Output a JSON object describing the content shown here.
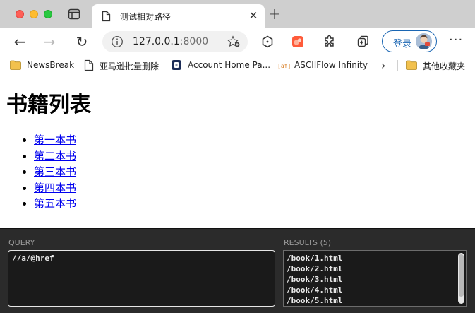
{
  "tab": {
    "title": "测试相对路径",
    "close_glyph": "✕",
    "new_tab_glyph": "+"
  },
  "toolbar": {
    "back_glyph": "←",
    "forward_glyph": "→",
    "reload_glyph": "↻",
    "url_host": "127.0.0.1",
    "url_port": ":8000",
    "login_label": "登录",
    "more_glyph": "···"
  },
  "bookmarks": {
    "items": [
      {
        "label": "NewsBreak",
        "icon": "folder-icon"
      },
      {
        "label": "亚马逊批量删除",
        "icon": "page-icon"
      },
      {
        "label": "Account Home Pa...",
        "icon": "account-icon"
      },
      {
        "label": "ASCIIFlow Infinity",
        "icon": "asciiflow-icon"
      }
    ],
    "overflow_glyph": "›",
    "other_folder_label": "其他收藏夹"
  },
  "page": {
    "heading": "书籍列表",
    "books": [
      "第一本书",
      "第二本书",
      "第三本书",
      "第四本书",
      "第五本书"
    ]
  },
  "xpath_panel": {
    "query_label": "QUERY",
    "query_value": "//a/@href",
    "results_label": "RESULTS (5)",
    "results": [
      "/book/1.html",
      "/book/2.html",
      "/book/3.html",
      "/book/4.html",
      "/book/5.html"
    ]
  },
  "colors": {
    "link": "#0000ee",
    "login_accent": "#1a66b3",
    "panel_bg": "#2b2b2b"
  }
}
